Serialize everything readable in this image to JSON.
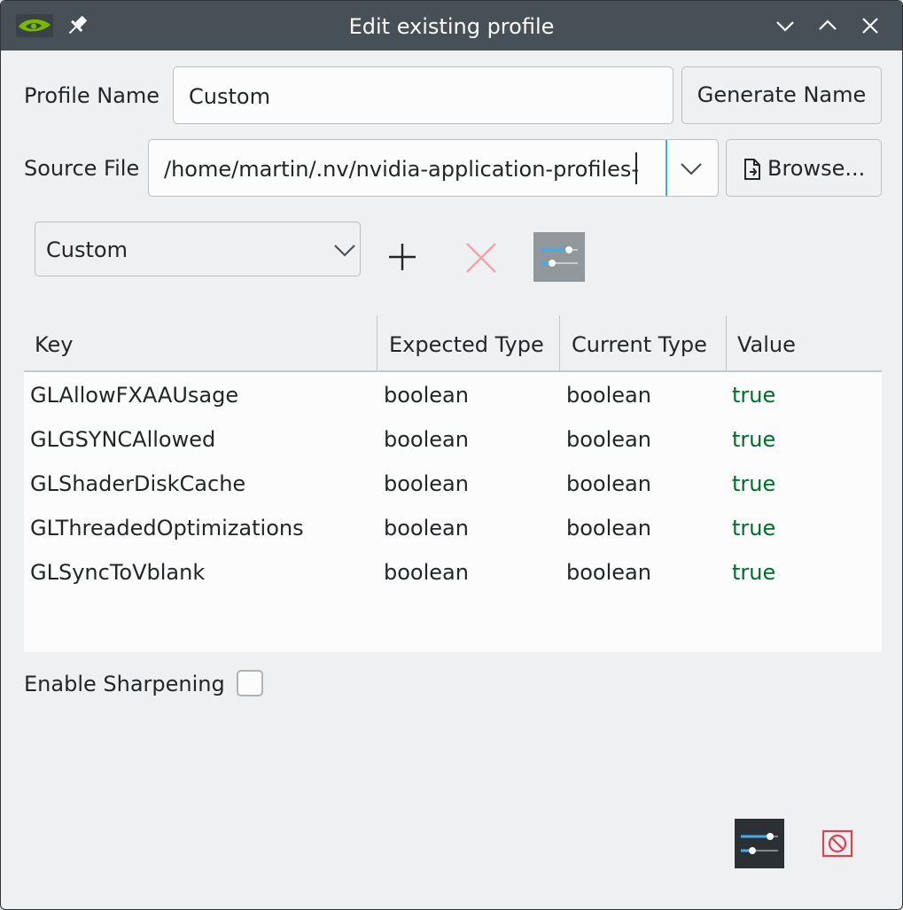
{
  "window": {
    "title": "Edit existing profile",
    "app_icon": "nvidia-logo-icon",
    "pin_icon": "pin-icon",
    "controls": [
      "minimize-icon",
      "maximize-icon",
      "close-icon"
    ]
  },
  "form": {
    "profile_name_label": "Profile Name",
    "profile_name_value": "Custom",
    "generate_name_button": "Generate Name",
    "source_file_label": "Source File",
    "source_file_value": "/home/martin/.nv/nvidia-application-profiles-",
    "browse_button": "Browse..."
  },
  "settings_toolbar": {
    "preset_selected": "Custom",
    "add_icon": "plus-icon",
    "remove_icon": "x-icon",
    "edit_icon": "sliders-icon"
  },
  "table": {
    "columns": [
      "Key",
      "Expected Type",
      "Current Type",
      "Value"
    ],
    "rows": [
      {
        "key": "GLAllowFXAAUsage",
        "expected": "boolean",
        "current": "boolean",
        "value": "true"
      },
      {
        "key": "GLGSYNCAllowed",
        "expected": "boolean",
        "current": "boolean",
        "value": "true"
      },
      {
        "key": "GLShaderDiskCache",
        "expected": "boolean",
        "current": "boolean",
        "value": "true"
      },
      {
        "key": "GLThreadedOptimizations",
        "expected": "boolean",
        "current": "boolean",
        "value": "true"
      },
      {
        "key": "GLSyncToVblank",
        "expected": "boolean",
        "current": "boolean",
        "value": "true"
      }
    ]
  },
  "sharpening": {
    "label": "Enable Sharpening",
    "checked": false
  },
  "footer": {
    "settings_icon": "sliders-icon",
    "cancel_icon": "cancel-icon"
  },
  "colors": {
    "titlebar": "#475057",
    "value_true": "#006e28",
    "accent": "#3daee9",
    "danger": "#da4453"
  }
}
